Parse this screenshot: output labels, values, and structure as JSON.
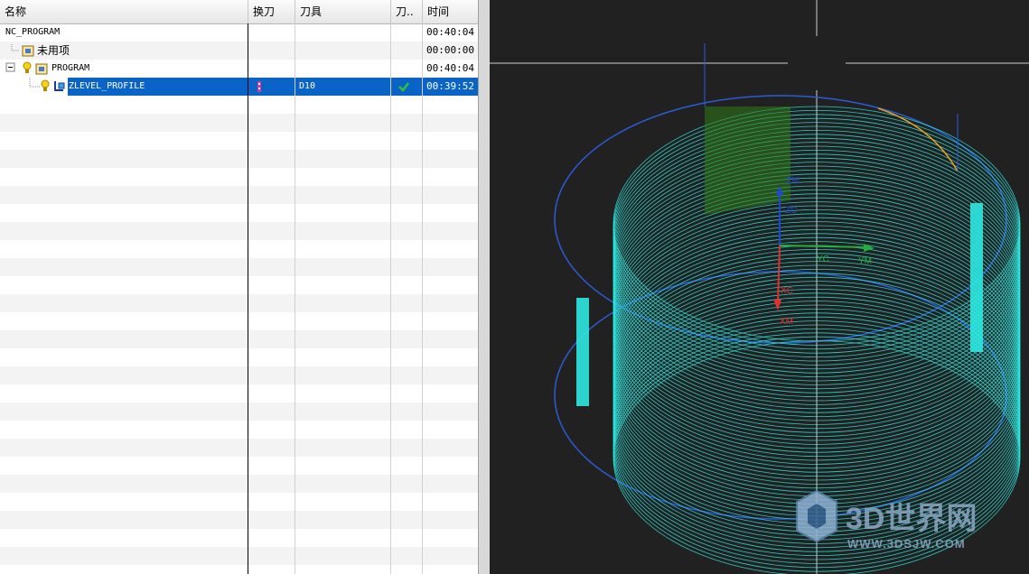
{
  "navigator": {
    "columns": {
      "name": "名称",
      "tool_change": "换刀",
      "tool": "刀具",
      "tool_path": "刀..",
      "time": "时间"
    },
    "rows": [
      {
        "name": "NC_PROGRAM",
        "tool": "",
        "time": "00:40:04"
      },
      {
        "name": "未用项",
        "tool": "",
        "time": "00:00:00"
      },
      {
        "name": "PROGRAM",
        "tool": "",
        "time": "00:40:04"
      },
      {
        "name": "ZLEVEL_PROFILE",
        "tool": "D10",
        "time": "00:39:52",
        "status_icon": "check-icon"
      }
    ]
  },
  "viewport": {
    "axes": {
      "zm": "ZM",
      "zc": "ZC",
      "yc": "YC",
      "ym": "YM",
      "xc": "XC",
      "xm": "XM"
    }
  },
  "watermark": {
    "brand": "3D世界网",
    "url": "WWW.3DSJW.COM"
  },
  "colors": {
    "selection": "#0a64c8",
    "toolpath": "#2ee8e0",
    "highlight": "#39a81e",
    "boundary": "#2b5bd6",
    "x_axis": "#e03030",
    "y_axis": "#22b03a",
    "z_axis": "#2244d6"
  }
}
